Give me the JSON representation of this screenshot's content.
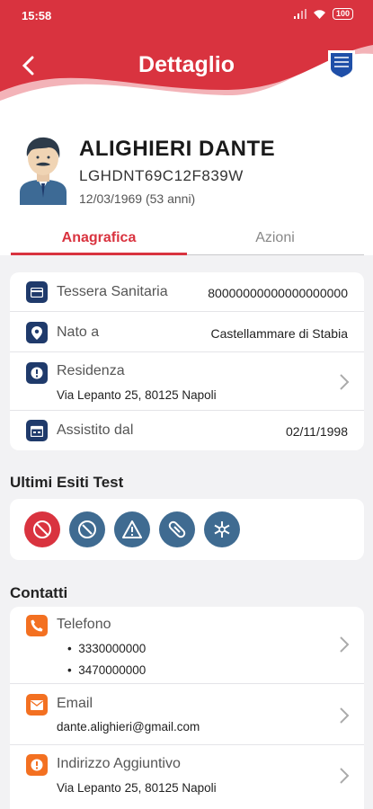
{
  "status_bar": {
    "time": "15:58",
    "battery": "100"
  },
  "header": {
    "title": "Dettaglio"
  },
  "profile": {
    "name": "ALIGHIERI DANTE",
    "fiscal_code": "LGHDNT69C12F839W",
    "birth": "12/03/1969 (53 anni)"
  },
  "tabs": [
    {
      "label": "Anagrafica",
      "active": true
    },
    {
      "label": "Azioni",
      "active": false
    }
  ],
  "anagrafica": {
    "tessera": {
      "label": "Tessera Sanitaria",
      "value": "80000000000000000000"
    },
    "nato": {
      "label": "Nato a",
      "value": "Castellammare di Stabia"
    },
    "residenza": {
      "label": "Residenza",
      "value": "Via Lepanto 25, 80125 Napoli"
    },
    "assistito": {
      "label": "Assistito dal",
      "value": "02/11/1998"
    }
  },
  "test_section": {
    "title": "Ultimi Esiti Test",
    "items": [
      {
        "icon": "blocked-icon",
        "color": "#d9333f"
      },
      {
        "icon": "slash-circle-icon",
        "color": "#3f6b91"
      },
      {
        "icon": "warning-icon",
        "color": "#3f6b91"
      },
      {
        "icon": "pill-icon",
        "color": "#3f6b91"
      },
      {
        "icon": "snowflake-icon",
        "color": "#3f6b91"
      }
    ]
  },
  "contacts": {
    "title": "Contatti",
    "telefono": {
      "label": "Telefono",
      "numbers": [
        "3330000000",
        "3470000000"
      ]
    },
    "email": {
      "label": "Email",
      "value": "dante.alighieri@gmail.com"
    },
    "indirizzo": {
      "label": "Indirizzo Aggiuntivo",
      "value": "Via Lepanto 25, 80125 Napoli"
    }
  },
  "colors": {
    "brand_red": "#d9333f",
    "navy": "#1f3a6b",
    "orange": "#f37021"
  }
}
